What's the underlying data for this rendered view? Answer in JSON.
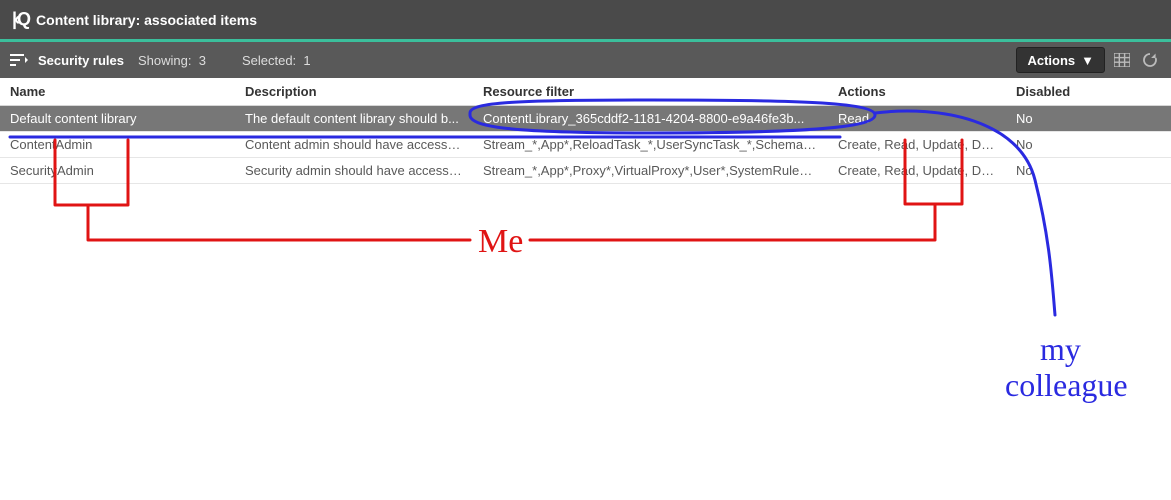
{
  "topbar": {
    "title": "Content library: associated items"
  },
  "toolbar": {
    "section_label": "Security rules",
    "showing_label": "Showing:",
    "showing_count": "3",
    "selected_label": "Selected:",
    "selected_count": "1",
    "actions_label": "Actions"
  },
  "columns": {
    "name": "Name",
    "description": "Description",
    "resource_filter": "Resource filter",
    "actions": "Actions",
    "disabled": "Disabled"
  },
  "rows": [
    {
      "selected": true,
      "name": "Default content library",
      "description": "The default content library should b...",
      "resource_filter": "ContentLibrary_365cddf2-1181-4204-8800-e9a46fe3b...",
      "actions": "Read",
      "disabled": "No"
    },
    {
      "selected": false,
      "name": "ContentAdmin",
      "description": "Content admin should have access r...",
      "resource_filter": "Stream_*,App*,ReloadTask_*,UserSyncTask_*,SchemaEv...",
      "actions": "Create, Read, Update, Del...",
      "disabled": "No"
    },
    {
      "selected": false,
      "name": "SecurityAdmin",
      "description": "Security admin should have access r...",
      "resource_filter": "Stream_*,App*,Proxy*,VirtualProxy*,User*,SystemRule_*,...",
      "actions": "Create, Read, Update, Del...",
      "disabled": "No"
    }
  ],
  "annotations": {
    "me_label": "Me",
    "colleague_label": "my\ncolleague"
  }
}
